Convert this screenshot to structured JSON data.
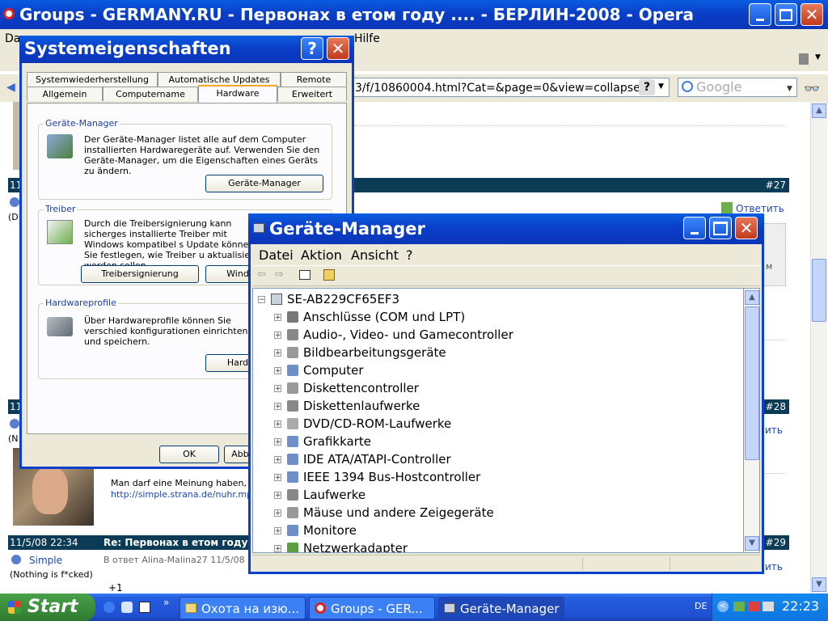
{
  "browser": {
    "title": "Groups - GERMANY.RU - Первонах в етом году .... - БЕРЛИН-2008 - Opera",
    "menu_partial_left": "Da",
    "menu_partial_right": "Hilfe",
    "address": "3/f/10860004.html?Cat=&page=0&view=collapse",
    "search_placeholder": "Google"
  },
  "forum": {
    "posts": [
      {
        "date": "11",
        "subject": "",
        "num": "#27",
        "reply": "Ответить"
      },
      {
        "date": "11",
        "subject": "",
        "num": "#28",
        "reply": "ить"
      },
      {
        "date": "11/5/08 22:34",
        "subject": "Re: Первонах в етом году",
        "num": "#29",
        "reply": "ить"
      }
    ],
    "quote_text": "Man darf eine Meinung haben, man",
    "quote_link": "http://simple.strana.de/nuhr.mp3",
    "author": "Simple",
    "author_status": "(Nothing is f*cked)",
    "reply_to": "В ответ Alina-Malina27 11/5/08",
    "post_body": "+1",
    "left_fragments": [
      "(D",
      "(N"
    ],
    "side_fragment": "м"
  },
  "sys_dialog": {
    "title": "Systemeigenschaften",
    "tabs_row1": [
      "Systemwiederherstellung",
      "Automatische Updates",
      "Remote"
    ],
    "tabs_row2": [
      "Allgemein",
      "Computername",
      "Hardware",
      "Erweitert"
    ],
    "device_manager_group": {
      "label": "Geräte-Manager",
      "text": "Der Geräte-Manager listet alle auf dem Computer installierten Hardwaregeräte auf. Verwenden Sie den Geräte-Manager, um die Eigenschaften eines Geräts zu ändern.",
      "button": "Geräte-Manager"
    },
    "driver_group": {
      "label": "Treiber",
      "text": "Durch die Treibersignierung kann sicherges installierte Treiber mit Windows kompatibel s Update können Sie festlegen, wie Treiber u aktualisiert werden sollen.",
      "button1": "Treibersignierung",
      "button2": "Wind"
    },
    "profiles_group": {
      "label": "Hardwareprofile",
      "text": "Über Hardwareprofile können Sie verschied konfigurationen einrichten und speichern.",
      "button": "Hard"
    },
    "ok": "OK",
    "cancel": "Abb"
  },
  "device_manager": {
    "title": "Geräte-Manager",
    "menu": [
      "Datei",
      "Aktion",
      "Ansicht",
      "?"
    ],
    "root": "SE-AB229CF65EF3",
    "items": [
      "Anschlüsse (COM und LPT)",
      "Audio-, Video- und Gamecontroller",
      "Bildbearbeitungsgeräte",
      "Computer",
      "Diskettencontroller",
      "Diskettenlaufwerke",
      "DVD/CD-ROM-Laufwerke",
      "Grafikkarte",
      "IDE ATA/ATAPI-Controller",
      "IEEE 1394 Bus-Hostcontroller",
      "Laufwerke",
      "Mäuse und andere Zeigegeräte",
      "Monitore",
      "Netzwerkadapter"
    ]
  },
  "taskbar": {
    "start": "Start",
    "tasks": [
      "Охота на изю...",
      "Groups - GER...",
      "Geräte-Manager"
    ],
    "language": "DE",
    "clock": "22:23"
  },
  "colors": {
    "xp_blue": "#0a3fc8",
    "forum_bar": "#0b3b55",
    "taskbar": "#245de0",
    "start_green": "#3b8e3b"
  }
}
